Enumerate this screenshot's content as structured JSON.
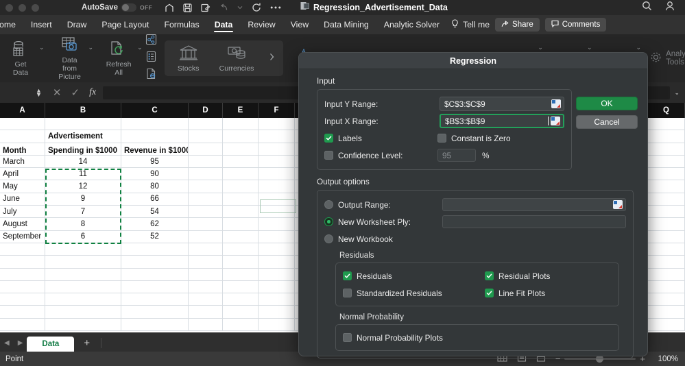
{
  "titlebar": {
    "autosave_label": "AutoSave",
    "autosave_state": "OFF",
    "document_title": "Regression_Advertisement_Data",
    "icons": [
      "home-icon",
      "save-icon",
      "new-comment-icon",
      "undo-icon",
      "redo-caret-icon",
      "redo-circle-icon",
      "more-icon",
      "excel-doc-icon",
      "search-icon",
      "account-icon"
    ]
  },
  "ribbon": {
    "tabs": [
      {
        "label": "ome",
        "active": false
      },
      {
        "label": "Insert",
        "active": false
      },
      {
        "label": "Draw",
        "active": false
      },
      {
        "label": "Page Layout",
        "active": false
      },
      {
        "label": "Formulas",
        "active": false
      },
      {
        "label": "Data",
        "active": true
      },
      {
        "label": "Review",
        "active": false
      },
      {
        "label": "View",
        "active": false
      },
      {
        "label": "Data Mining",
        "active": false
      },
      {
        "label": "Analytic Solver",
        "active": false
      }
    ],
    "tell_me": "Tell me",
    "share": "Share",
    "comments": "Comments",
    "groups": [
      {
        "label1": "Get",
        "label2": "Data",
        "icon": "get-data-icon",
        "caret": true
      },
      {
        "label1": "Data from",
        "label2": "Picture",
        "icon": "data-from-picture-icon",
        "caret": true
      },
      {
        "label1": "Refresh",
        "label2": "All",
        "icon": "refresh-all-icon",
        "caret": true
      }
    ],
    "stocks": "Stocks",
    "currencies": "Currencies",
    "analysis_tools": "Analysis Tools"
  },
  "formula_bar": {
    "value": "",
    "fx_label": "fx",
    "cancel_icon": "x-icon",
    "accept_icon": "check-icon"
  },
  "grid": {
    "columns": [
      "A",
      "B",
      "C",
      "D",
      "E",
      "F",
      "Q"
    ],
    "rows": [
      [
        "",
        "",
        "",
        "",
        "",
        ""
      ],
      [
        "",
        "Advertisement",
        "",
        "",
        "",
        ""
      ],
      [
        "Month",
        "Spending in $1000",
        "Revenue in $1000",
        "",
        "",
        ""
      ],
      [
        "March",
        "14",
        "95",
        "",
        "",
        ""
      ],
      [
        "April",
        "11",
        "90",
        "",
        "",
        ""
      ],
      [
        "May",
        "12",
        "80",
        "",
        "",
        ""
      ],
      [
        "June",
        "9",
        "66",
        "",
        "",
        ""
      ],
      [
        "July",
        "7",
        "54",
        "",
        "",
        ""
      ],
      [
        "August",
        "8",
        "62",
        "",
        "",
        ""
      ],
      [
        "September",
        "6",
        "52",
        "",
        "",
        ""
      ],
      [
        "",
        "",
        "",
        "",
        "",
        ""
      ],
      [
        "",
        "",
        "",
        "",
        "",
        ""
      ],
      [
        "",
        "",
        "",
        "",
        "",
        ""
      ],
      [
        "",
        "",
        "",
        "",
        "",
        ""
      ],
      [
        "",
        "",
        "",
        "",
        "",
        ""
      ],
      [
        "",
        "",
        "",
        "",
        "",
        ""
      ],
      [
        "",
        "",
        "",
        "",
        "",
        ""
      ]
    ],
    "selected_cell_tooltip": "F8",
    "marching_ants_range": "B4:B10"
  },
  "dialog": {
    "title": "Regression",
    "input_section_label": "Input",
    "input_y_label": "Input Y Range:",
    "input_y_value": "$C$3:$C$9",
    "input_x_label": "Input X Range:",
    "input_x_value": "$B$3:$B$9",
    "labels_checkbox": "Labels",
    "labels_checked": true,
    "constant_is_zero_checkbox": "Constant is Zero",
    "constant_is_zero_checked": false,
    "confidence_level_checkbox": "Confidence Level:",
    "confidence_level_checked": false,
    "confidence_level_value": "95",
    "percent_sign": "%",
    "output_options_label": "Output options",
    "output_range_radio": "Output Range:",
    "output_range_selected": false,
    "output_range_value": "",
    "new_worksheet_ply_radio": "New Worksheet Ply:",
    "new_worksheet_ply_selected": true,
    "new_worksheet_ply_value": "",
    "new_workbook_radio": "New Workbook",
    "new_workbook_selected": false,
    "residuals_group_label": "Residuals",
    "residuals_checkbox": "Residuals",
    "residuals_checked": true,
    "residual_plots_checkbox": "Residual Plots",
    "residual_plots_checked": true,
    "standardized_residuals_checkbox": "Standardized Residuals",
    "standardized_residuals_checked": false,
    "line_fit_plots_checkbox": "Line Fit Plots",
    "line_fit_plots_checked": true,
    "normal_probability_group_label": "Normal Probability",
    "normal_probability_plots_checkbox": "Normal Probability Plots",
    "normal_probability_plots_checked": false,
    "ok_button": "OK",
    "cancel_button": "Cancel"
  },
  "sheet_bar": {
    "tabs": [
      "Data"
    ],
    "add_label": "+"
  },
  "status_bar": {
    "mode": "Point",
    "zoom": "100%",
    "view_icons": [
      "normal-view-icon",
      "page-layout-icon",
      "page-break-icon"
    ],
    "zoom_out": "−",
    "zoom_in": "+"
  },
  "colors": {
    "accent_green": "#1f9a4e",
    "dialog_bg": "#333739",
    "ribbon_bg": "#262626",
    "marching_ants": "#0f8040"
  }
}
